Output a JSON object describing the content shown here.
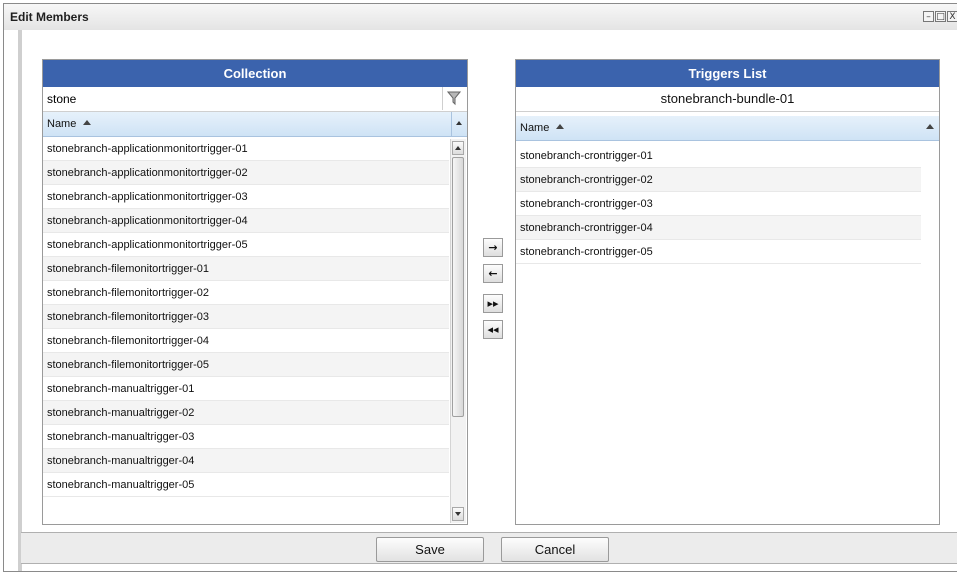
{
  "window": {
    "title": "Edit Members",
    "controls": [
      "–",
      "□",
      "X"
    ]
  },
  "collection": {
    "header": "Collection",
    "filter_value": "stone",
    "column_name": "Name",
    "items": [
      "stonebranch-applicationmonitortrigger-01",
      "stonebranch-applicationmonitortrigger-02",
      "stonebranch-applicationmonitortrigger-03",
      "stonebranch-applicationmonitortrigger-04",
      "stonebranch-applicationmonitortrigger-05",
      "stonebranch-filemonitortrigger-01",
      "stonebranch-filemonitortrigger-02",
      "stonebranch-filemonitortrigger-03",
      "stonebranch-filemonitortrigger-04",
      "stonebranch-filemonitortrigger-05",
      "stonebranch-manualtrigger-01",
      "stonebranch-manualtrigger-02",
      "stonebranch-manualtrigger-03",
      "stonebranch-manualtrigger-04",
      "stonebranch-manualtrigger-05"
    ]
  },
  "triggers": {
    "header": "Triggers List",
    "bundle_name": "stonebranch-bundle-01",
    "column_name": "Name",
    "items": [
      "stonebranch-crontrigger-01",
      "stonebranch-crontrigger-02",
      "stonebranch-crontrigger-03",
      "stonebranch-crontrigger-04",
      "stonebranch-crontrigger-05"
    ]
  },
  "move_buttons": {
    "add": "→",
    "remove": "←",
    "add_all": "▸▸",
    "remove_all": "◂◂"
  },
  "footer": {
    "save_label": "Save",
    "cancel_label": "Cancel"
  },
  "colors": {
    "panel_header": "#3b63ad",
    "column_header": "#d8e8f7"
  }
}
